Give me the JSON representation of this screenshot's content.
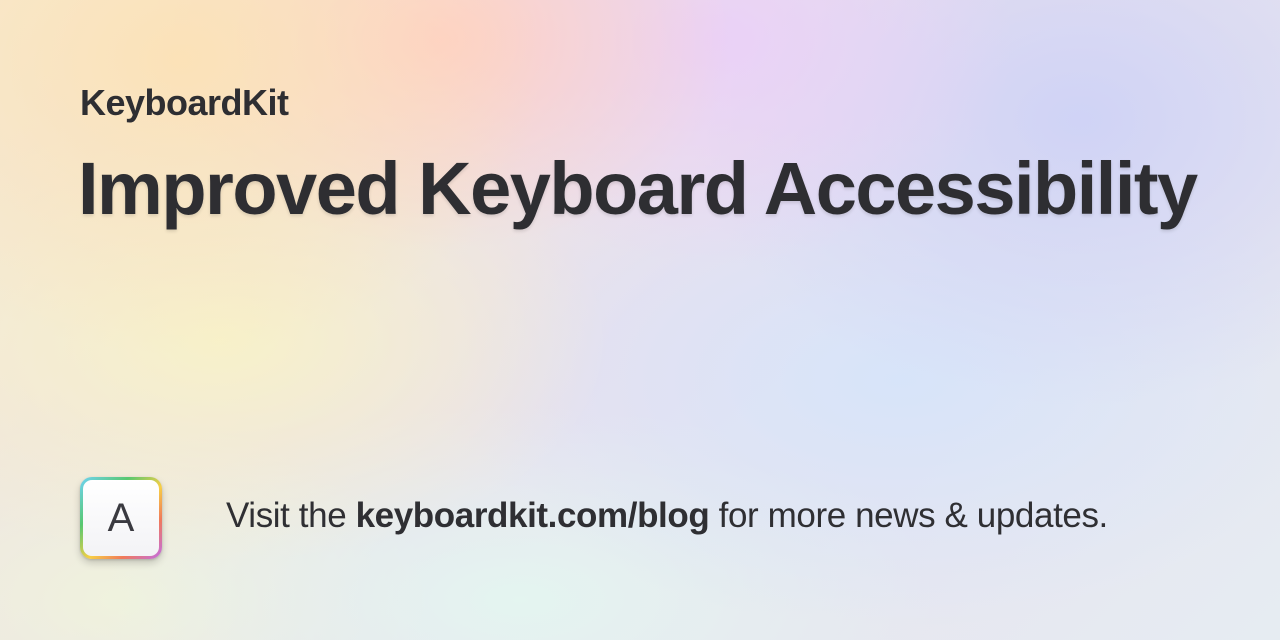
{
  "brand": {
    "name": "KeyboardKit"
  },
  "headline": {
    "title": "Improved Keyboard Accessibility"
  },
  "app_icon": {
    "letter": "A",
    "icon": "keyboard-key-icon"
  },
  "footer": {
    "prefix": "Visit the ",
    "link": "keyboardkit.com/blog",
    "suffix": " for more news & updates."
  }
}
